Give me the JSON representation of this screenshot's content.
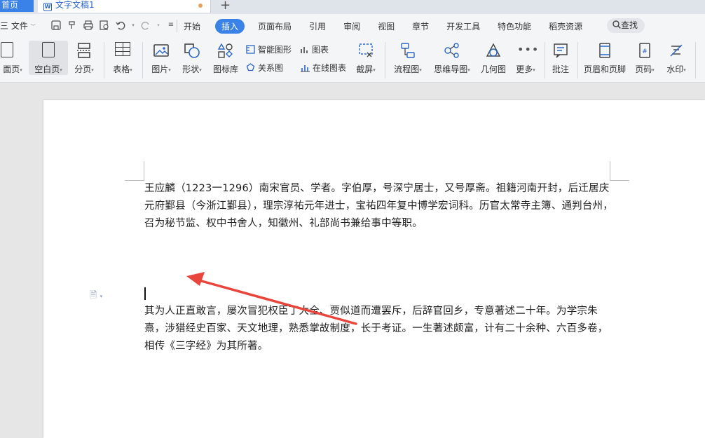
{
  "tabs": {
    "home": "首页",
    "document": "文字文稿1",
    "add": "+"
  },
  "menu": {
    "file": "三 文件",
    "tabs": [
      "开始",
      "插入",
      "页面布局",
      "引用",
      "审阅",
      "视图",
      "章节",
      "开发工具",
      "特色功能",
      "稻壳资源"
    ],
    "active_tab": "插入",
    "search": "查找"
  },
  "ribbon": {
    "cover": "面页",
    "blank_page": "空白页",
    "page_break": "分页",
    "table": "表格",
    "picture": "图片",
    "shape": "形状",
    "icon_lib": "图标库",
    "smart_graphic": "智能图形",
    "chart": "图表",
    "relation": "关系图",
    "online_chart": "在线图表",
    "screenshot": "截屏",
    "flowchart": "流程图",
    "mindmap": "思维导图",
    "geometry": "几何图",
    "more": "更多",
    "comment": "批注",
    "header_footer": "页眉和页脚",
    "page_number": "页码",
    "watermark": "水印"
  },
  "document": {
    "para1": "王应麟（1223一1296）南宋官员、学者。字伯厚，号深宁居士，又号厚斋。祖籍河南开封，后迁居庆元府鄞县（今浙江鄞县），理宗淳祐元年进士，宝祐四年复中博学宏词科。历官太常寺主簿、通判台州，召为秘节监、权中书舍人，知徽州、礼部尚书兼给事中等职。",
    "para2": "其为人正直敢言，屡次冒犯权臣丁大全、贾似道而遭罢斥，后辞官回乡，专意著述二十年。为学宗朱熹，涉猎经史百家、天文地理，熟悉掌故制度，长于考证。一生著述颇富，计有二十余种、六百多卷，相传《三字经》为其所著。"
  },
  "colors": {
    "accent": "#3b82e8",
    "arrow": "#e8453c"
  }
}
